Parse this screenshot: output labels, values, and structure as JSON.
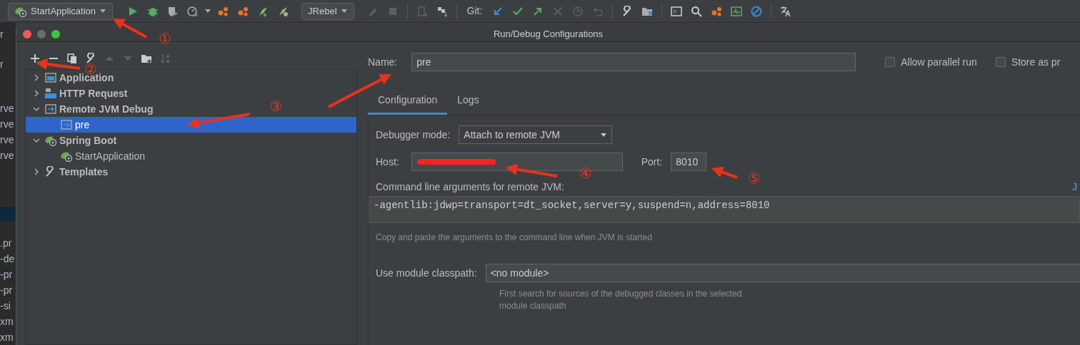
{
  "toolbar": {
    "run_config": "StartApplication",
    "jrebel_combo": "JRebel",
    "git_label": "Git:"
  },
  "ide_background": {
    "fragments": [
      "r",
      "r",
      "rve",
      "rve",
      "rve",
      "rve",
      ".pr",
      "-de",
      "-pr",
      "-pr",
      "-si",
      "xm",
      "xm"
    ]
  },
  "dialog": {
    "title": "Run/Debug Configurations",
    "tree": [
      {
        "label": "Application",
        "kind": "application",
        "expanded": false,
        "selected": false
      },
      {
        "label": "HTTP Request",
        "kind": "http",
        "expanded": false,
        "selected": false
      },
      {
        "label": "Remote JVM Debug",
        "kind": "remote",
        "expanded": true,
        "selected": false,
        "children": [
          {
            "label": "pre",
            "kind": "remote",
            "selected": true
          }
        ]
      },
      {
        "label": "Spring Boot",
        "kind": "spring",
        "expanded": true,
        "selected": false,
        "children": [
          {
            "label": "StartApplication",
            "kind": "spring",
            "selected": false
          }
        ]
      },
      {
        "label": "Templates",
        "kind": "templates",
        "expanded": false,
        "selected": false
      }
    ],
    "name_label": "Name:",
    "name_value": "pre",
    "checkboxes": [
      {
        "label": "Allow parallel run",
        "checked": false
      },
      {
        "label": "Store as pr",
        "checked": false
      }
    ],
    "tabs": [
      {
        "label": "Configuration",
        "selected": true
      },
      {
        "label": "Logs",
        "selected": false
      }
    ],
    "debugger_mode_label": "Debugger mode:",
    "debugger_mode_value": "Attach to remote JVM",
    "host_label": "Host:",
    "port_label": "Port:",
    "port_value": "8010",
    "args_label": "Command line arguments for remote JVM:",
    "args_link": "J",
    "args_value": "-agentlib:jdwp=transport=dt_socket,server=y,suspend=n,address=8010",
    "args_hint": "Copy and paste the arguments to the command line when JVM is started",
    "module_label": "Use module classpath:",
    "module_value": "<no module>",
    "module_hint": [
      "First search for sources of the debugged classes in the selected",
      "module classpath"
    ]
  },
  "annotations": [
    {
      "label": "①"
    },
    {
      "label": "②"
    },
    {
      "label": "③"
    },
    {
      "label": "④"
    },
    {
      "label": "⑤"
    }
  ]
}
